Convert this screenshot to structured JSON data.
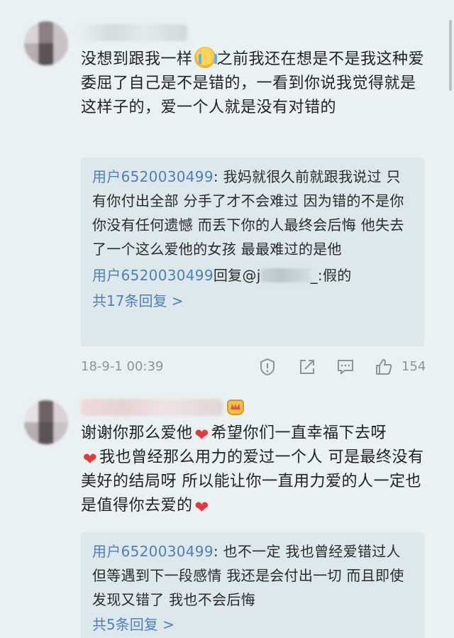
{
  "comments": [
    {
      "text_parts": [
        "没想到跟我一样",
        "之前我还在想是不是我这种爱委屈了自己是不是错的，一看到你说我觉得就是这样子的，爱一个人就是没有对错的"
      ],
      "replies": [
        {
          "user": "用户6520030499",
          "text": ": 我妈就很久前就跟我说过 只有你付出全部 分手了才不会难过 因为错的不是你你没有任何遗憾  而丢下你的人最终会后悔 他失去了一个这么爱他的女孩 最最难过的是他"
        },
        {
          "user": "用户6520030499",
          "text_before": "回复@j",
          "text_after": "_:假的"
        }
      ],
      "more_replies": "共17条回复 >",
      "timestamp": "18-9-1 00:39",
      "likes": "154"
    },
    {
      "text_parts": [
        "谢谢你那么爱他",
        "希望你们一直幸福下去呀",
        "我也曾经那么用力的爱过一个人 可是最终没有美好的结局呀 所以能让你一直用力爱的人一定也是值得你去爱的"
      ],
      "replies": [
        {
          "user": "用户6520030499",
          "text": ": 也不一定 我也曾经爱错过人 但等遇到下一段感情 我还是会付出一切 而且即使发现又错了 我也不会后悔"
        }
      ],
      "more_replies": "共5条回复 >"
    }
  ],
  "icons": {
    "cry": "crying-face-icon",
    "heart": "red-heart-icon",
    "crown": "crown-badge-icon",
    "report": "report-icon",
    "share": "share-icon",
    "comment": "comment-icon",
    "like": "like-icon"
  },
  "colors": {
    "background": "#e9f1f3",
    "reply_box": "#dde8ec",
    "link": "#4f80b5",
    "heart": "#e03a3a",
    "meta": "#8d9498"
  }
}
